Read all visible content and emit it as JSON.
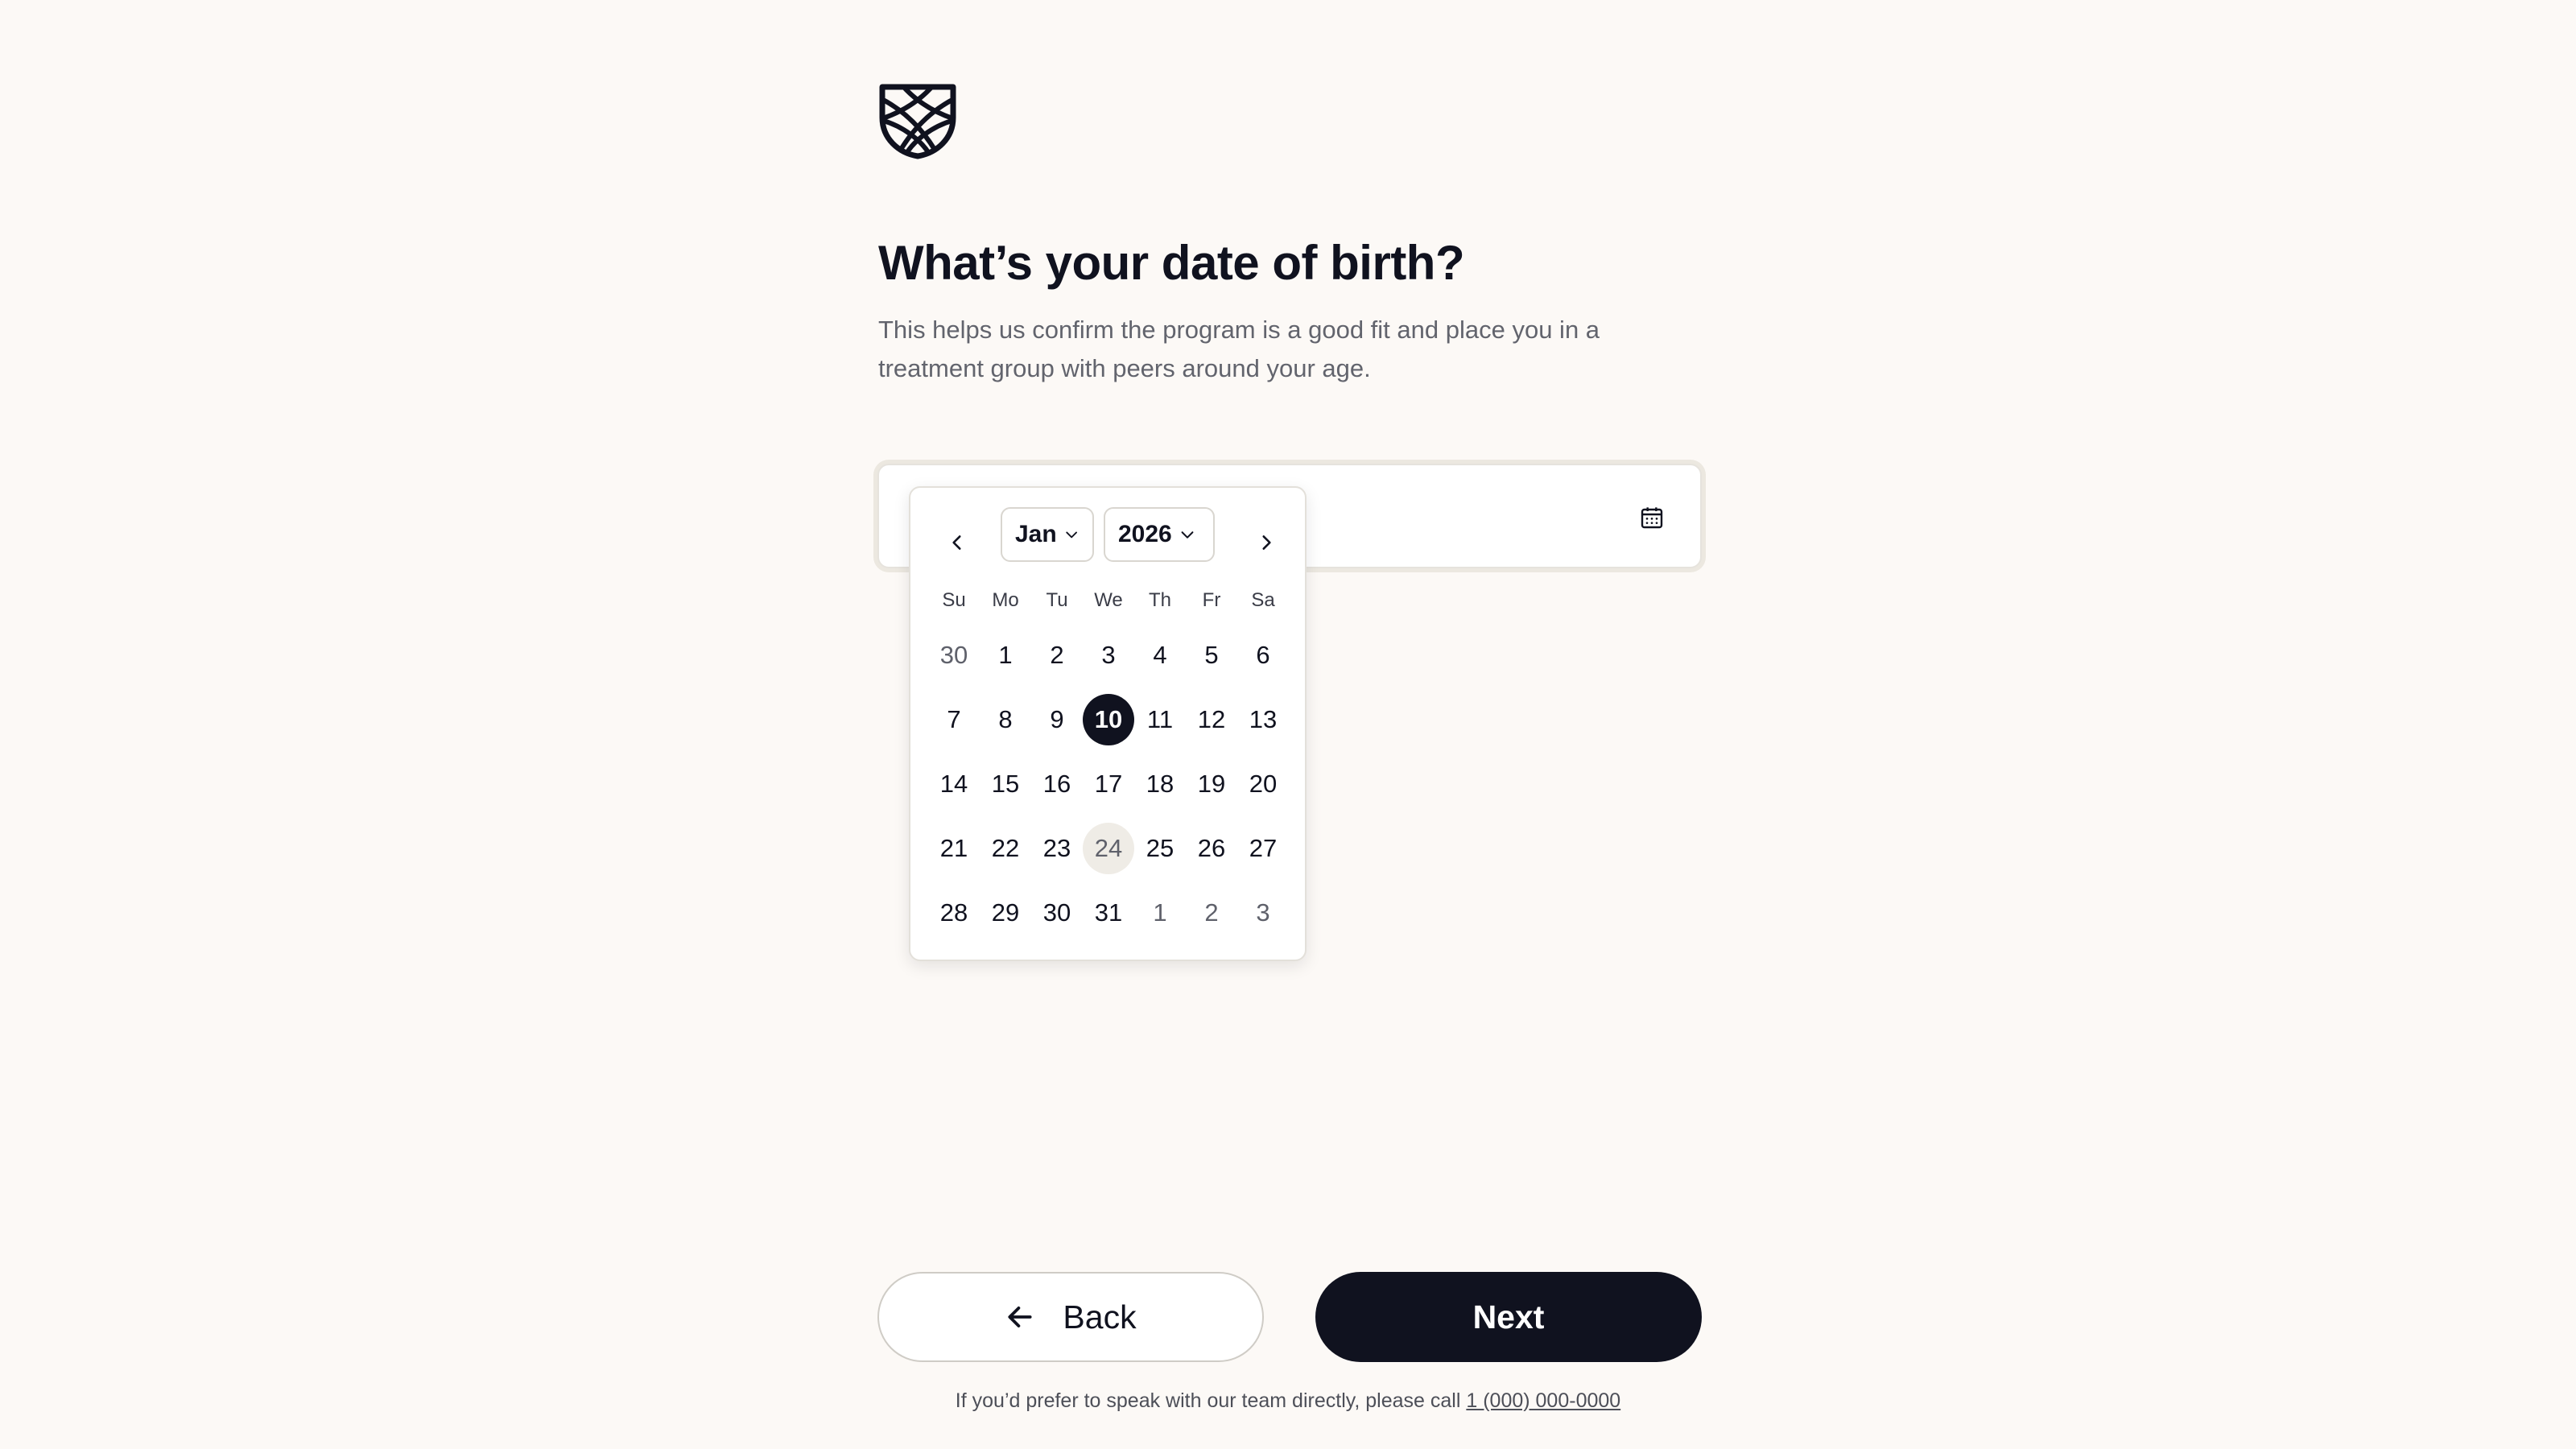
{
  "header": {
    "logo_icon": "shield-lattice-logo"
  },
  "question": {
    "title": "What’s your date of birth?",
    "subtitle": "This helps us confirm the program is a good fit and place you in a treatment group with peers around your age."
  },
  "date_input": {
    "value": "",
    "calendar_icon": "calendar-icon"
  },
  "calendar": {
    "month": "Jan",
    "year": "2026",
    "weekdays": [
      "Su",
      "Mo",
      "Tu",
      "We",
      "Th",
      "Fr",
      "Sa"
    ],
    "days": [
      {
        "label": "30",
        "other": true
      },
      {
        "label": "1"
      },
      {
        "label": "2"
      },
      {
        "label": "3"
      },
      {
        "label": "4"
      },
      {
        "label": "5"
      },
      {
        "label": "6"
      },
      {
        "label": "7"
      },
      {
        "label": "8"
      },
      {
        "label": "9"
      },
      {
        "label": "10",
        "selected": true
      },
      {
        "label": "11"
      },
      {
        "label": "12"
      },
      {
        "label": "13"
      },
      {
        "label": "14"
      },
      {
        "label": "15"
      },
      {
        "label": "16"
      },
      {
        "label": "17"
      },
      {
        "label": "18"
      },
      {
        "label": "19"
      },
      {
        "label": "20"
      },
      {
        "label": "21"
      },
      {
        "label": "22"
      },
      {
        "label": "23"
      },
      {
        "label": "24",
        "today": true
      },
      {
        "label": "25"
      },
      {
        "label": "26"
      },
      {
        "label": "27"
      },
      {
        "label": "28"
      },
      {
        "label": "29"
      },
      {
        "label": "30"
      },
      {
        "label": "31"
      },
      {
        "label": "1",
        "other": true
      },
      {
        "label": "2",
        "other": true
      },
      {
        "label": "3",
        "other": true
      }
    ]
  },
  "buttons": {
    "back_label": "Back",
    "next_label": "Next"
  },
  "footer": {
    "text": "If you’d prefer to speak with our team directly, please call",
    "phone": "1 (000) 000-0000"
  },
  "colors": {
    "background": "#fcf9f6",
    "primary": "#10121f",
    "today_highlight": "#efece6"
  }
}
